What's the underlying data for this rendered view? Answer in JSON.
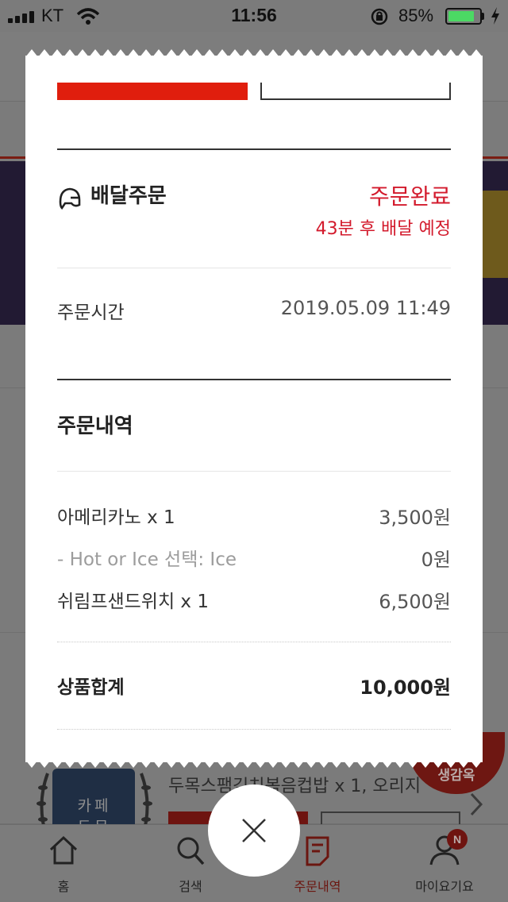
{
  "status_bar": {
    "carrier": "KT",
    "time": "11:56",
    "battery_percent": "85%",
    "battery_level": 0.85
  },
  "background": {
    "cup_text_1": "카페",
    "cup_text_2": "두목",
    "order_line": "두목스팸김치볶음컵밥 x 1, 오리지",
    "badge": "생감옥"
  },
  "receipt": {
    "delivery_label": "배달주문",
    "delivery_icon": "helmet-icon",
    "status": "주문완료",
    "eta": "43분 후 배달 예정",
    "order_time_label": "주문시간",
    "order_time_value": "2019.05.09 11:49",
    "order_details_title": "주문내역",
    "items": [
      {
        "name": "아메리카노 x 1",
        "price": "3,500원"
      },
      {
        "name": "- Hot or Ice 선택: Ice",
        "price": "0원",
        "option": true
      },
      {
        "name": "쉬림프샌드위치 x 1",
        "price": "6,500원"
      }
    ],
    "subtotal_label": "상품합계",
    "subtotal_value": "10,000원"
  },
  "tab_bar": {
    "tabs": [
      {
        "label": "홈",
        "icon": "home-icon"
      },
      {
        "label": "검색",
        "icon": "search-icon"
      },
      {
        "label": "주문내역",
        "icon": "receipt-icon",
        "active": true
      },
      {
        "label": "마이요기요",
        "icon": "person-icon"
      }
    ],
    "notification_badge": "N"
  },
  "close_icon": "close-icon",
  "colors": {
    "accent_red": "#e01e0d",
    "status_red": "#d31a2c",
    "battery_green": "#4cd964"
  }
}
